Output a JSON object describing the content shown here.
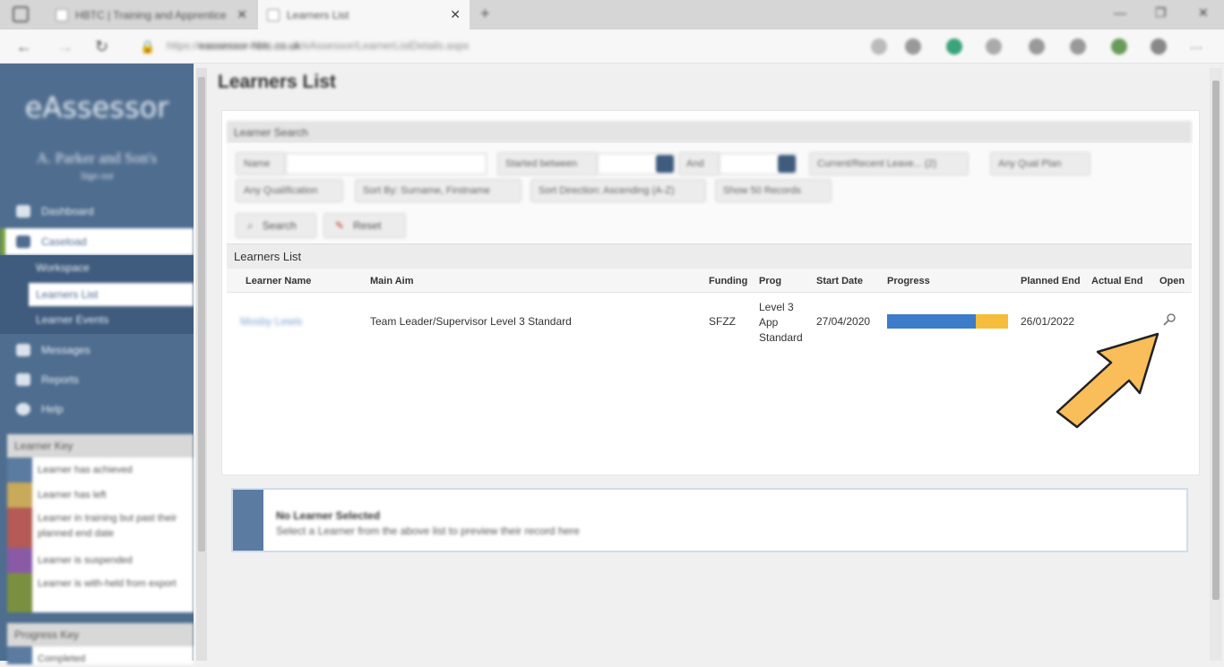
{
  "browser": {
    "tabs": [
      {
        "title": "HBTC | Training and Apprentice",
        "active": false
      },
      {
        "title": "Learners List",
        "active": true
      }
    ],
    "new_tab": "+",
    "url_prefix": "https://",
    "url_host": "eassessor-hbtc.co.uk",
    "url_path": "/eAssessor/LearnerListDetails.aspx"
  },
  "sidebar": {
    "logo": "eAssessor",
    "org": "A. Parker and Son's",
    "signout": "Sign out",
    "nav": [
      {
        "label": "Dashboard",
        "icon": "dashboard-icon"
      },
      {
        "label": "Caseload",
        "icon": "caseload-icon",
        "selected": true
      },
      {
        "label": "Messages",
        "icon": "messages-icon"
      },
      {
        "label": "Reports",
        "icon": "reports-icon"
      },
      {
        "label": "Help",
        "icon": "help-icon"
      }
    ],
    "subnav": [
      {
        "label": "Workspace"
      },
      {
        "label": "Learners List",
        "selected": true
      },
      {
        "label": "Learner Events"
      }
    ],
    "learner_key": {
      "title": "Learner Key",
      "items": [
        {
          "label": "Learner has achieved",
          "color": "#5b7ba1"
        },
        {
          "label": "Learner has left",
          "color": "#c9a95a"
        },
        {
          "label": "Learner in training but past their planned end date",
          "color": "#b55a55"
        },
        {
          "label": "Learner is suspended",
          "color": "#8a5aa6"
        },
        {
          "label": "Learner is with-held from export",
          "color": "#7a9040"
        }
      ]
    },
    "progress_key": {
      "title": "Progress Key",
      "items": [
        {
          "label": "Completed",
          "color": "#5b7ba1"
        }
      ]
    }
  },
  "main": {
    "title": "Learners List",
    "search": {
      "header": "Learner Search",
      "name_label": "Name",
      "started_between_label": "Started between",
      "and_label": "And",
      "leave_filter": "Current/Recent Leave... (2)",
      "qual_plan_filter": "Any Qual Plan",
      "qualification_filter": "Any Qualification",
      "sort_by": "Sort By: Surname, Firstname",
      "sort_direction": "Sort Direction: Ascending (A-Z)",
      "show_records": "Show 50 Records",
      "search_button": "Search",
      "reset_button": "Reset"
    },
    "list": {
      "header": "Learners List",
      "columns": [
        "Learner Name",
        "Main Aim",
        "Funding",
        "Prog",
        "Start Date",
        "Progress",
        "Planned End",
        "Actual End",
        "Open"
      ],
      "rows": [
        {
          "learner_name": "Mosby Lewis",
          "main_aim": "Team Leader/Supervisor Level 3 Standard",
          "funding": "SFZZ",
          "prog_line1": "Level 3",
          "prog_line2": "App",
          "prog_line3": "Standard",
          "start_date": "27/04/2020",
          "progress_completed": 0.73,
          "progress_remaining": 0.27,
          "planned_end": "26/01/2022",
          "actual_end": ""
        }
      ]
    },
    "no_selection": {
      "title": "No Learner Selected",
      "message": "Select a Learner from the above list to preview their record here"
    }
  },
  "colors": {
    "sidebar_bg": "#4f6d8f",
    "progress_blue": "#3d7cc9",
    "progress_yellow": "#f5bd3b",
    "arrow_fill": "#f9bd5a",
    "selected_accent": "#7aa03c"
  }
}
